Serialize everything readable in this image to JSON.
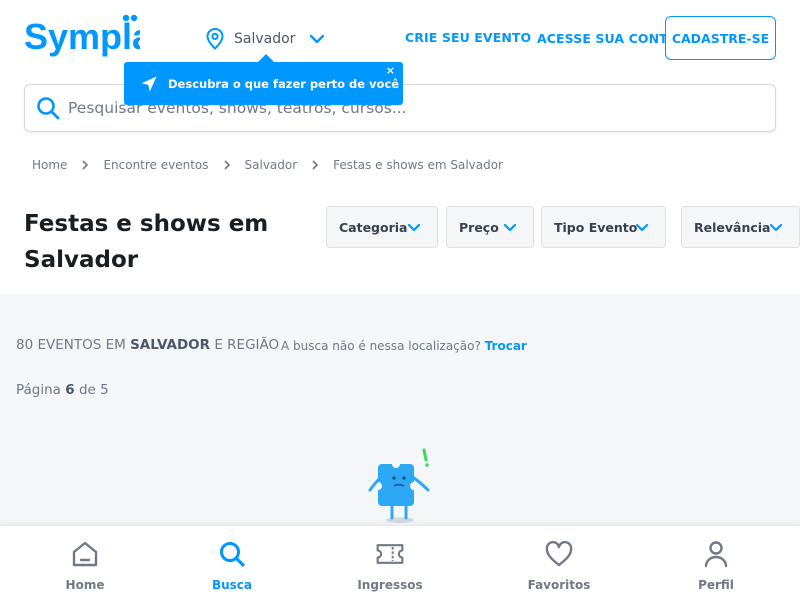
{
  "brand": {
    "logo_text": "Sympla",
    "primary_color": "#0097ff",
    "text_color": "#191e23",
    "muted_color": "#6f7988"
  },
  "header": {
    "location": {
      "label": "Salvador",
      "icon": "map-pin-icon"
    },
    "links": {
      "crie_evento": "CRIE SEU EVENTO",
      "acesse_conta": "ACESSE SUA CONTA"
    },
    "signup_label": "CADASTRE-SE"
  },
  "tooltip": {
    "text": "Descubra o que fazer perto de você",
    "close": "×",
    "icon": "navigation-arrow-icon"
  },
  "search": {
    "placeholder": "Pesquisar eventos, shows, teatros, cursos...",
    "value": ""
  },
  "breadcrumb": [
    "Home",
    "Encontre eventos",
    "Salvador",
    "Festas e shows em Salvador"
  ],
  "page_title": "Festas e shows em Salvador",
  "filters": [
    "Categoria",
    "Preço",
    "Tipo Evento",
    "Relevância"
  ],
  "results": {
    "count_prefix": "80 EVENTOS EM",
    "count_city": "SALVADOR",
    "count_suffix": "E REGIÃO",
    "relocate_question": "A busca não é nessa localização?",
    "relocate_action": "Trocar",
    "page_prefix": "Página",
    "page_current": "6",
    "page_suffix": "de 5"
  },
  "bottom_nav": [
    {
      "label": "Home",
      "icon": "home-icon",
      "active": false
    },
    {
      "label": "Busca",
      "icon": "search-icon",
      "active": true
    },
    {
      "label": "Ingressos",
      "icon": "ticket-icon",
      "active": false
    },
    {
      "label": "Favoritos",
      "icon": "heart-icon",
      "active": false
    },
    {
      "label": "Perfil",
      "icon": "user-icon",
      "active": false
    }
  ]
}
